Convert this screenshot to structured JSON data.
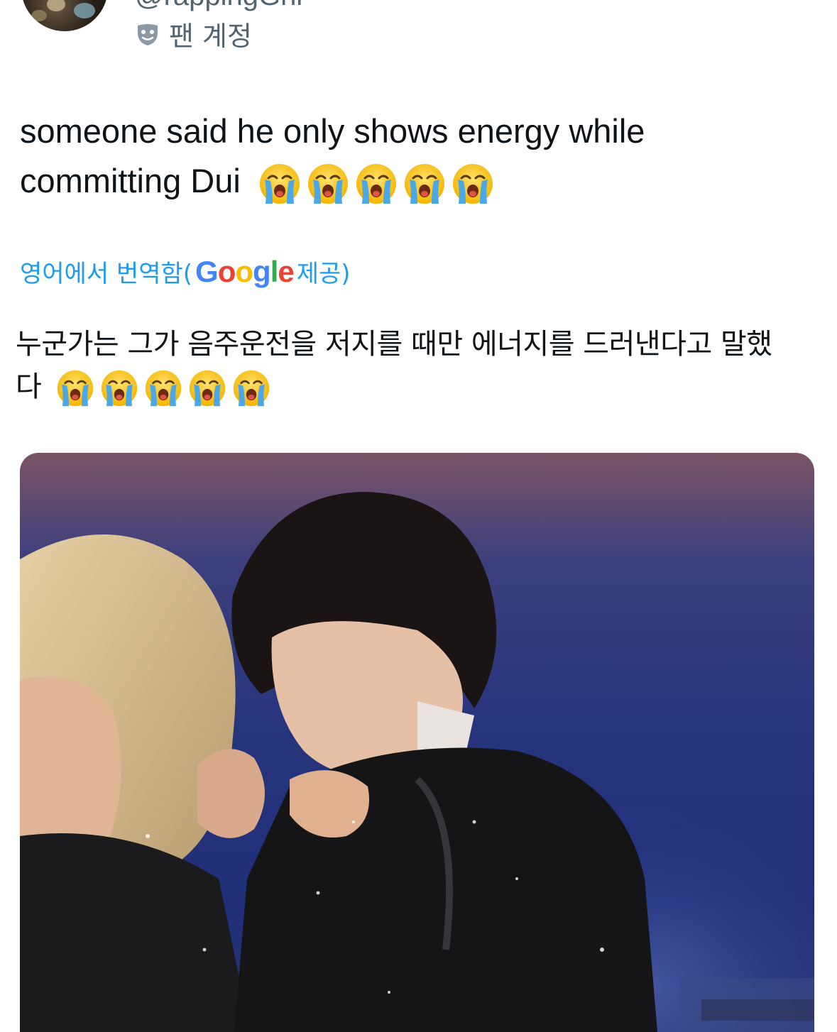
{
  "header": {
    "handle": "@rappingGhi",
    "badge_label": "팬 계정",
    "badge_icon": "fan-mask-icon"
  },
  "tweet": {
    "line1": "someone said he only shows energy while",
    "line2": "committing Dui",
    "emoji_name": "loudly-crying-face",
    "emoji_count": 5
  },
  "translation": {
    "prefix": "영어에서 번역함(",
    "provider": "Google",
    "suffix": " 제공)",
    "text_line1": "누군가는 그가 음주운전을 저지를 때만 에너지를 드러낸다고 말했",
    "text_line2": "다"
  },
  "media": {
    "type": "video-still",
    "description_icon": "video-media"
  },
  "colors": {
    "text": "#0f1419",
    "muted": "#536471",
    "link": "#1d9bf0"
  }
}
